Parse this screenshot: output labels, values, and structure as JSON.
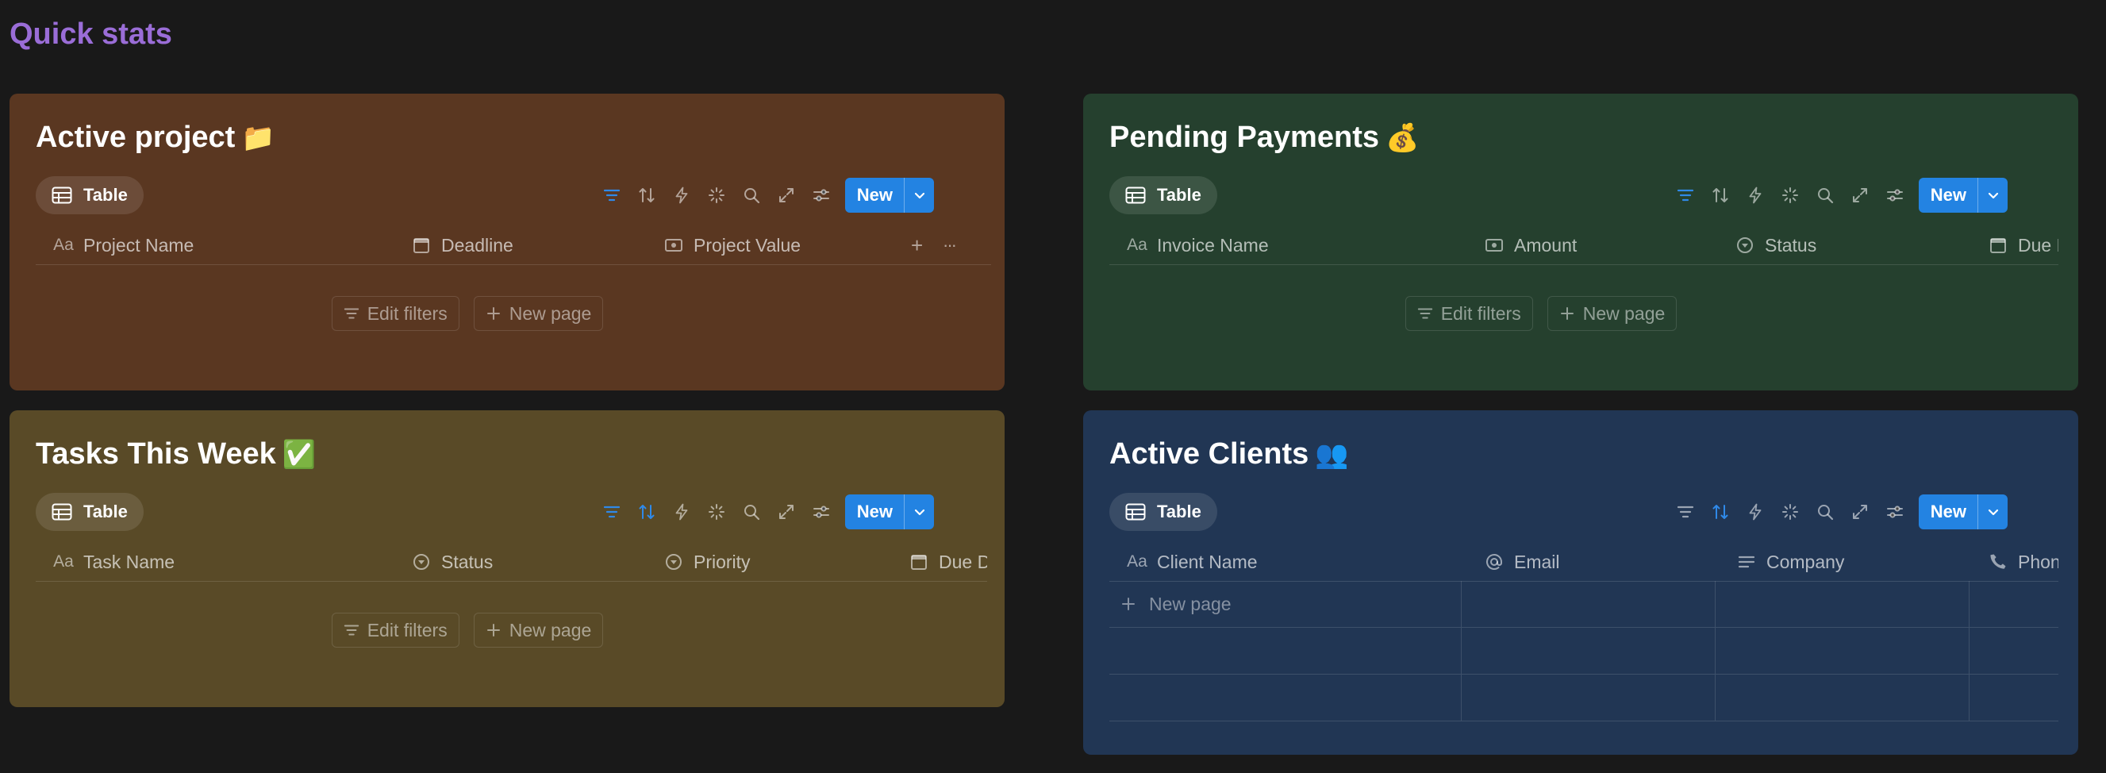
{
  "page": {
    "heading": "Quick stats"
  },
  "colors": {
    "background": "#191919",
    "heading": "#9a6dd7",
    "accent": "#2383e2",
    "card_brown": "#5a3721",
    "card_green": "#25402e",
    "card_yellow": "#594a27",
    "card_blue": "#213654"
  },
  "common": {
    "view_label": "Table",
    "new_label": "New",
    "edit_filters": "Edit filters",
    "new_page": "New page",
    "add_icon": "+",
    "more_icon": "···"
  },
  "cards": [
    {
      "title": "Active project",
      "emoji": "📁",
      "columns": [
        {
          "label": "Project Name",
          "icon": "title-icon"
        },
        {
          "label": "Deadline",
          "icon": "calendar-icon"
        },
        {
          "label": "Project Value",
          "icon": "number-icon"
        }
      ]
    },
    {
      "title": "Pending Payments",
      "emoji": "💰",
      "columns": [
        {
          "label": "Invoice Name",
          "icon": "title-icon"
        },
        {
          "label": "Amount",
          "icon": "number-icon"
        },
        {
          "label": "Status",
          "icon": "status-icon"
        },
        {
          "label": "Due D",
          "icon": "calendar-icon"
        }
      ]
    },
    {
      "title": "Tasks This Week",
      "emoji": "✅",
      "columns": [
        {
          "label": "Task Name",
          "icon": "title-icon"
        },
        {
          "label": "Status",
          "icon": "status-icon"
        },
        {
          "label": "Priority",
          "icon": "status-icon"
        },
        {
          "label": "Due D",
          "icon": "calendar-icon"
        }
      ]
    },
    {
      "title": "Active Clients",
      "emoji": "👥",
      "columns": [
        {
          "label": "Client Name",
          "icon": "title-icon"
        },
        {
          "label": "Email",
          "icon": "at-icon"
        },
        {
          "label": "Company",
          "icon": "text-icon"
        },
        {
          "label": "Phone",
          "icon": "phone-icon"
        }
      ]
    }
  ]
}
